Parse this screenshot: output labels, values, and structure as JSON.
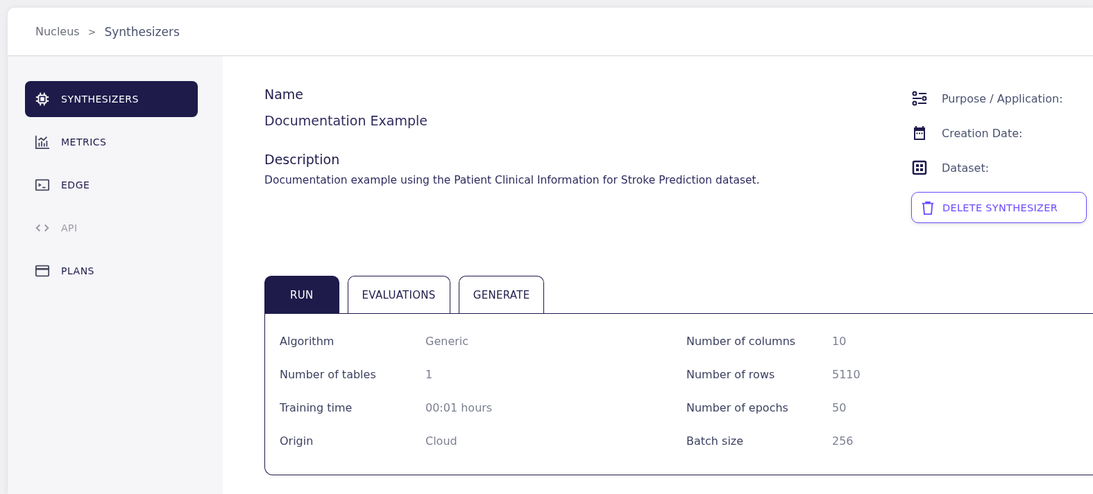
{
  "breadcrumb": {
    "items": [
      {
        "label": "Nucleus",
        "selected": false
      },
      {
        "label": "Synthesizers",
        "selected": true
      }
    ],
    "separator": ">"
  },
  "sidebar": {
    "items": [
      {
        "label": "SYNTHESIZERS",
        "kind": "chip",
        "selected": true,
        "disabled": false
      },
      {
        "label": "METRICS",
        "kind": "chart",
        "selected": false,
        "disabled": false
      },
      {
        "label": "EDGE",
        "kind": "terminal",
        "selected": false,
        "disabled": false
      },
      {
        "label": "API",
        "kind": "code",
        "selected": false,
        "disabled": true
      },
      {
        "label": "PLANS",
        "kind": "card",
        "selected": false,
        "disabled": false
      }
    ]
  },
  "details": {
    "name_label": "Name",
    "name": "Documentation Example",
    "description_label": "Description",
    "description": "Documentation example using the Patient Clinical Information for Stroke Prediction dataset."
  },
  "info": [
    {
      "kind": "purpose",
      "label": "Purpose / Application:"
    },
    {
      "kind": "date",
      "label": "Creation Date:"
    },
    {
      "kind": "dataset",
      "label": "Dataset:"
    }
  ],
  "delete_button": "DELETE SYNTHESIZER",
  "tabs": [
    {
      "label": "RUN",
      "selected": true
    },
    {
      "label": "EVALUATIONS",
      "selected": false
    },
    {
      "label": "GENERATE",
      "selected": false
    }
  ],
  "run": {
    "left": [
      {
        "label": "Algorithm",
        "value": "Generic"
      },
      {
        "label": "Number of tables",
        "value": "1"
      },
      {
        "label": "Training time",
        "value": "00:01 hours"
      },
      {
        "label": "Origin",
        "value": "Cloud"
      }
    ],
    "right": [
      {
        "label": "Number of columns",
        "value": "10"
      },
      {
        "label": "Number of rows",
        "value": "5110"
      },
      {
        "label": "Number of epochs",
        "value": "50"
      },
      {
        "label": "Batch size",
        "value": "256"
      }
    ]
  }
}
